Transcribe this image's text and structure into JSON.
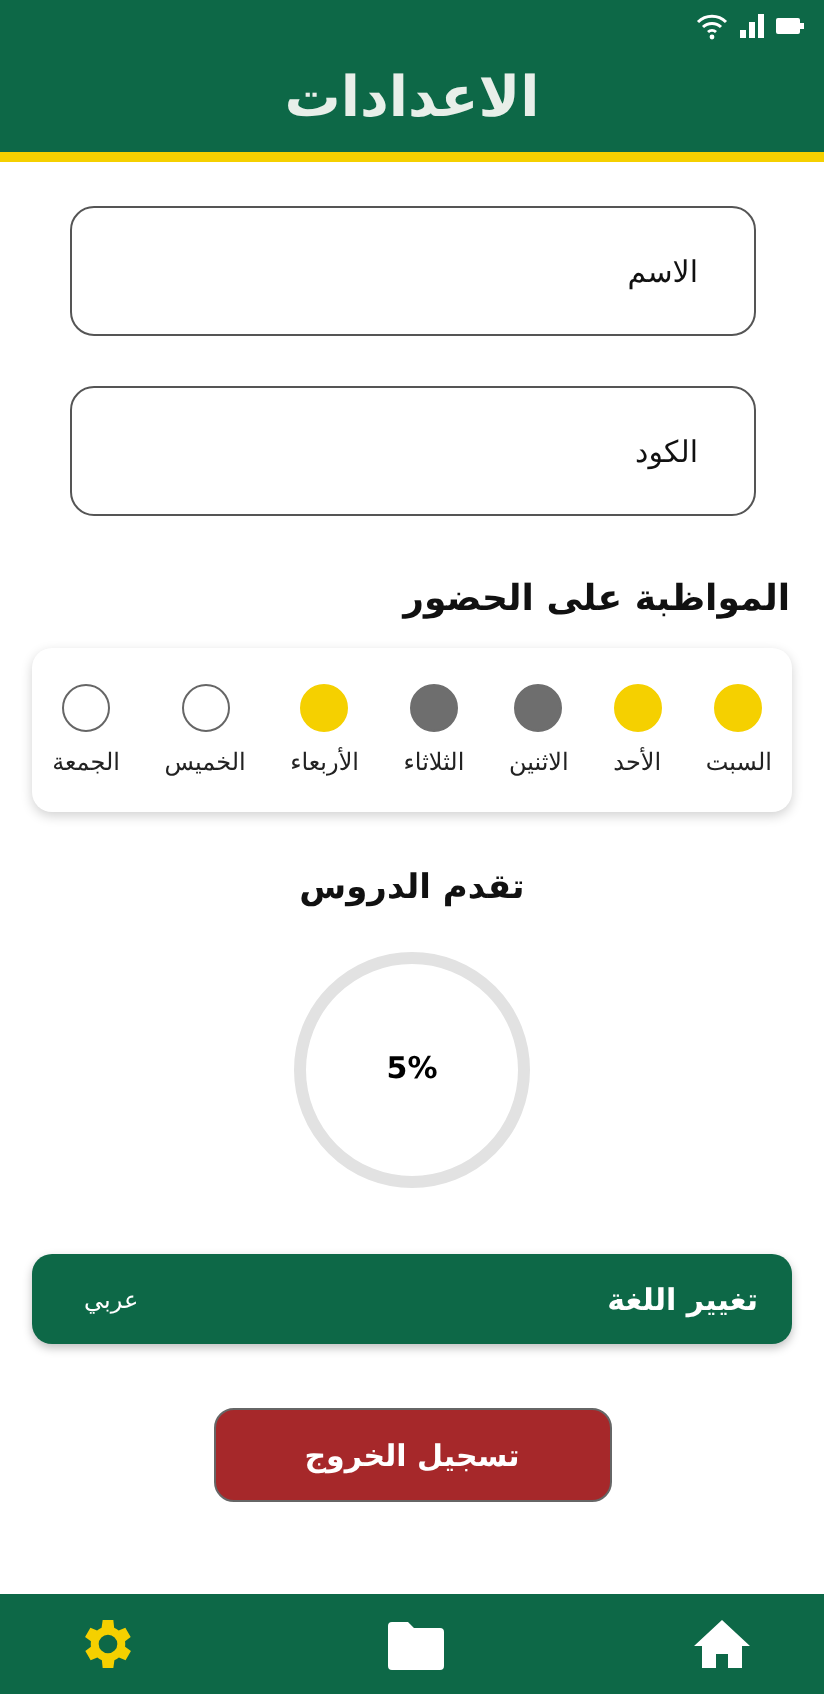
{
  "header": {
    "title": "الاعدادات"
  },
  "fields": [
    {
      "placeholder": "الاسم"
    },
    {
      "placeholder": "الكود"
    }
  ],
  "attendance": {
    "title": "المواظبة على الحضور",
    "days": [
      {
        "label": "السبت",
        "color": "#f5d000"
      },
      {
        "label": "الأحد",
        "color": "#f5d000"
      },
      {
        "label": "الاثنين",
        "color": "#6e6e6e"
      },
      {
        "label": "الثلاثاء",
        "color": "#6e6e6e"
      },
      {
        "label": "الأربعاء",
        "color": "#f5d000"
      },
      {
        "label": "الخميس",
        "color": "#ffffff"
      },
      {
        "label": "الجمعة",
        "color": "#ffffff"
      }
    ]
  },
  "progress": {
    "title": "تقدم الدروس",
    "reading": "5%"
  },
  "language": {
    "label": "تغيير اللغة",
    "value": "عربي"
  },
  "logout": {
    "label": "تسجيل الخروج"
  },
  "nav": [
    {
      "kind": "home",
      "selected": false
    },
    {
      "kind": "folder",
      "selected": false
    },
    {
      "kind": "settings",
      "selected": true
    }
  ]
}
